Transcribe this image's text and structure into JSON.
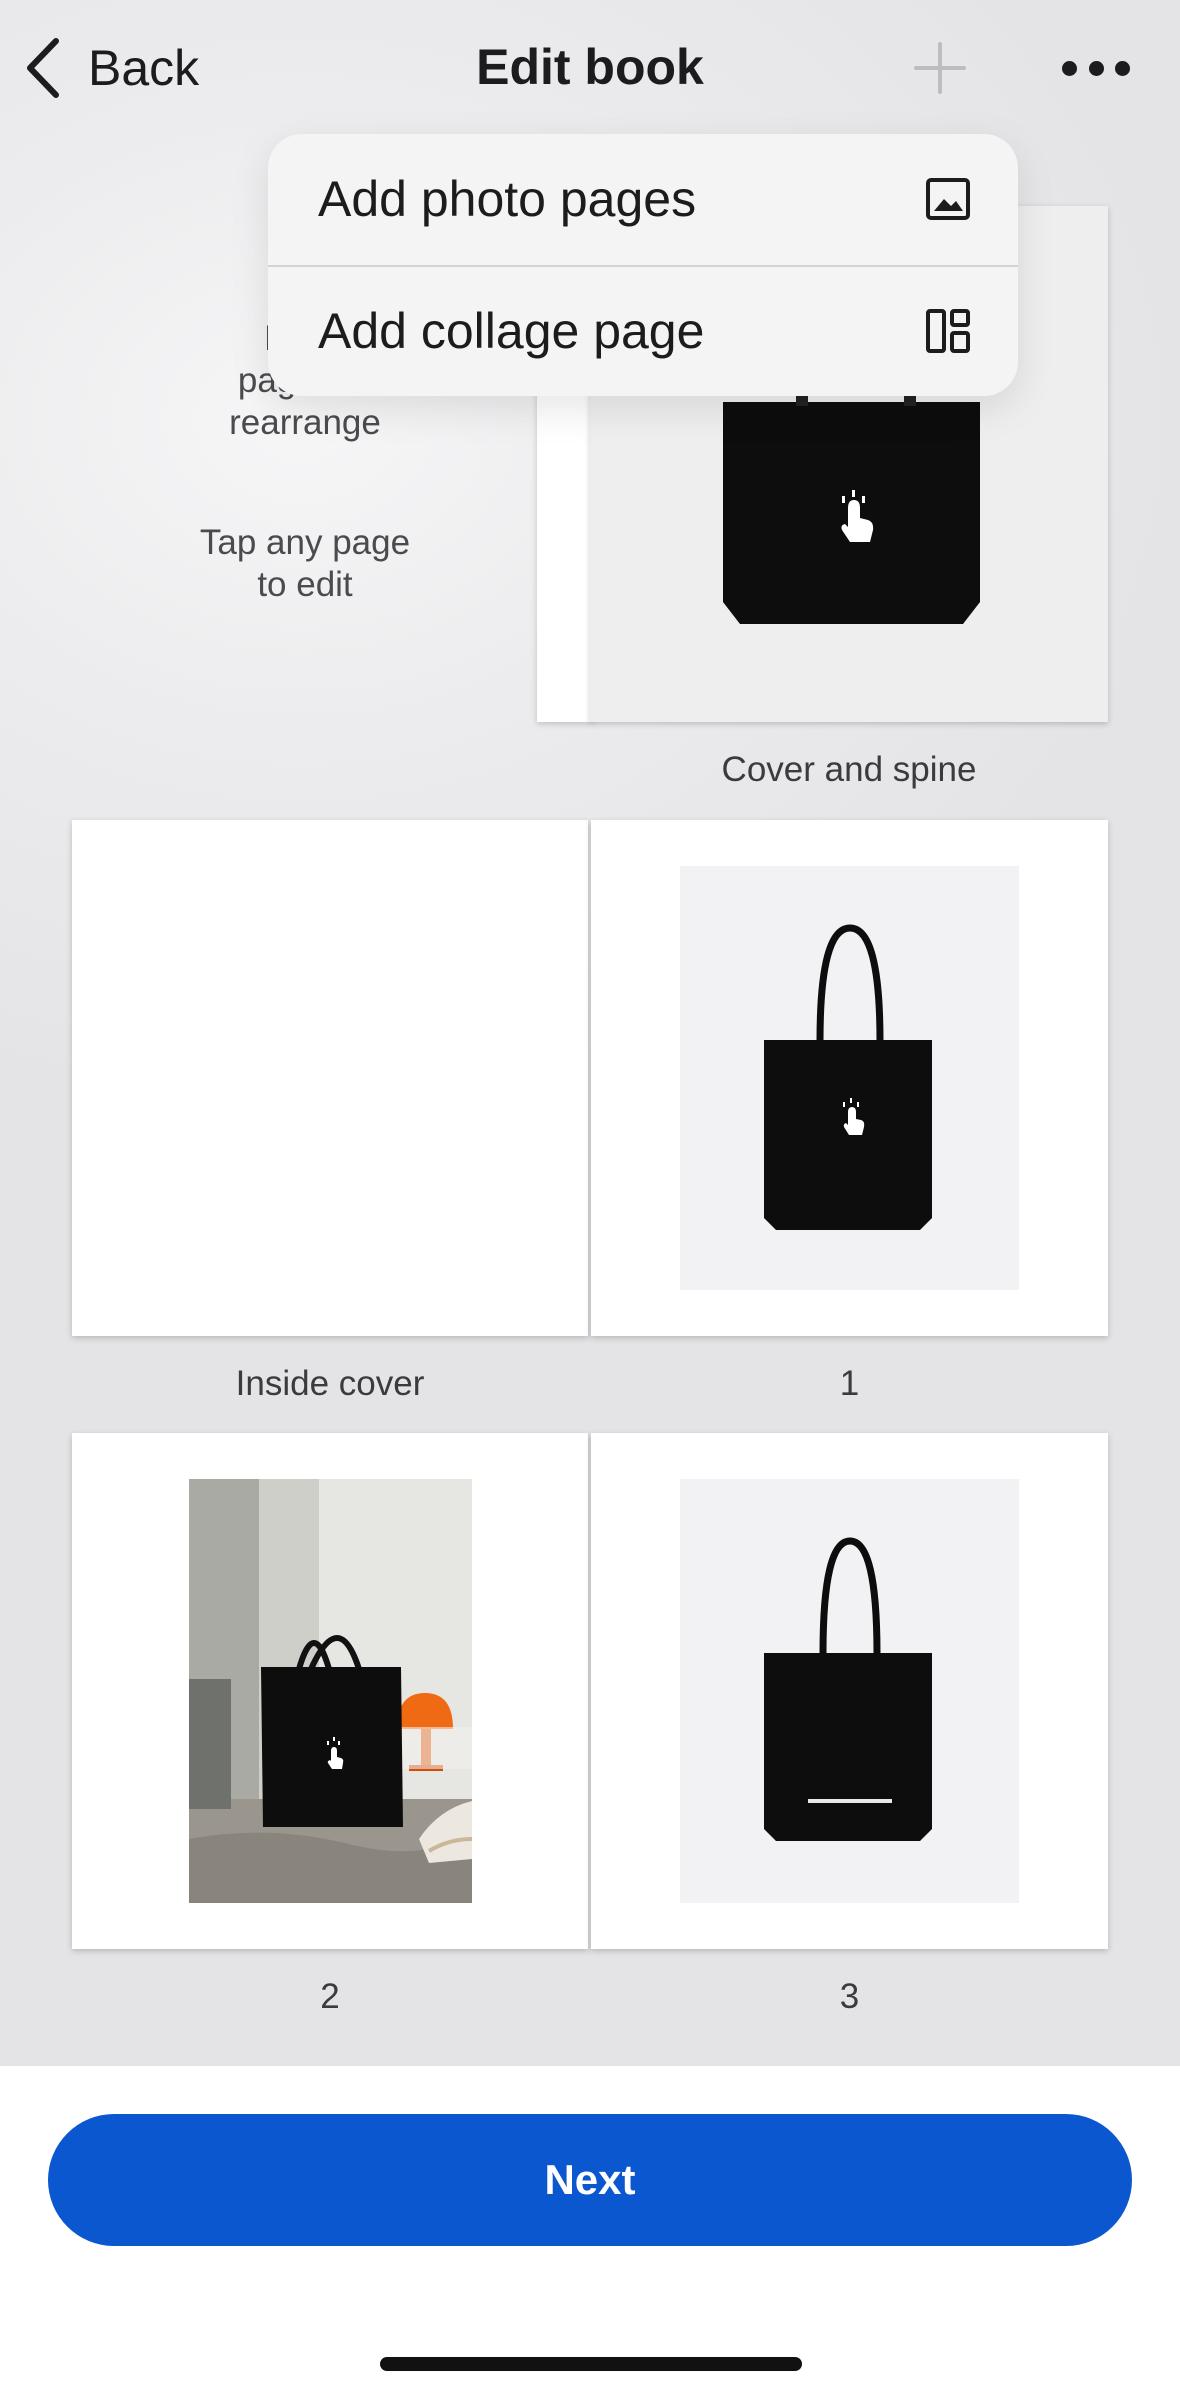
{
  "header": {
    "back_label": "Back",
    "title": "Edit book",
    "add_icon": "plus-icon",
    "more_icon": "more-horizontal-icon"
  },
  "menu": {
    "items": [
      {
        "label": "Add photo pages",
        "icon": "image-icon"
      },
      {
        "label": "Add collage page",
        "icon": "collage-layout-icon"
      }
    ]
  },
  "instructions": {
    "rearrange": "Hold, drag pages to rearrange",
    "rearrange_visible_top": "Hold,",
    "rearrange_visible_mid": "pages to",
    "rearrange_visible_bottom": "rearrange",
    "edit_line1": "Tap any page",
    "edit_line2": "to edit"
  },
  "pages": {
    "cover_caption": "Cover and spine",
    "inside_cover_caption": "Inside cover",
    "page1_caption": "1",
    "page2_caption": "2",
    "page3_caption": "3"
  },
  "footer": {
    "next_label": "Next"
  },
  "colors": {
    "accent": "#0b57d0",
    "background": "#e4e4e6",
    "menu_background": "#f4f4f5"
  }
}
